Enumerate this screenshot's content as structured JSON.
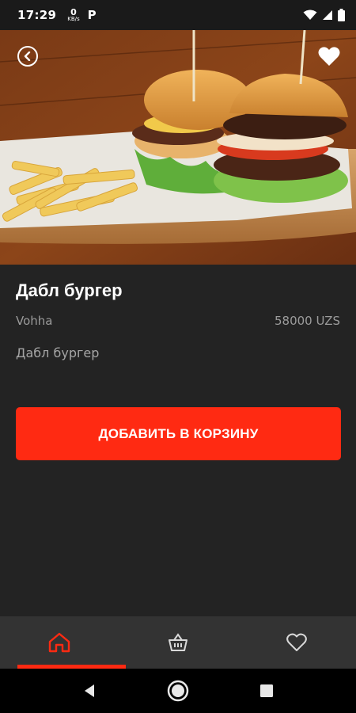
{
  "status_bar": {
    "time": "17:29",
    "data_speed": "0",
    "data_unit": "KB/s",
    "carrier_icon_letter": "P",
    "icons": [
      "wifi-icon",
      "signal-icon",
      "battery-icon"
    ]
  },
  "product": {
    "title": "Дабл бургер",
    "brand": "Vohha",
    "price": "58000 UZS",
    "description": "Дабл бургер",
    "image": "double-burger-with-fries-photo"
  },
  "actions": {
    "add_to_cart_label": "ДОБАВИТЬ В КОРЗИНУ"
  },
  "bottom_nav": {
    "items": [
      {
        "icon": "home-icon",
        "active": true
      },
      {
        "icon": "basket-icon",
        "active": false
      },
      {
        "icon": "heart-icon",
        "active": false
      }
    ]
  },
  "colors": {
    "accent": "#ff2a12",
    "background": "#232323",
    "nav_background": "#333333",
    "muted_text": "#9b9b9b"
  }
}
